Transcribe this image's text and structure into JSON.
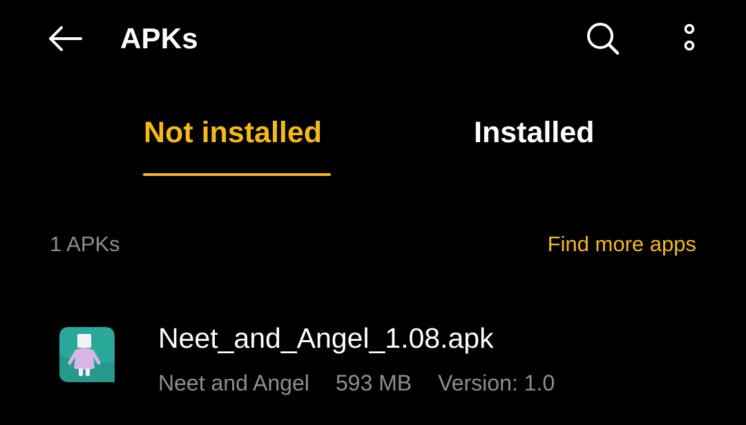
{
  "header": {
    "title": "APKs",
    "back_icon": "arrow-left-icon",
    "search_icon": "search-icon",
    "more_icon": "more-vertical-icon"
  },
  "tabs": [
    {
      "label": "Not installed",
      "active": true
    },
    {
      "label": "Installed",
      "active": false
    }
  ],
  "summary": {
    "count_label": "1 APKs",
    "find_more_label": "Find more apps"
  },
  "apks": [
    {
      "file_name": "Neet_and_Angel_1.08.apk",
      "app_name": "Neet and Angel",
      "size": "593 MB",
      "version": "Version: 1.0",
      "icon": "neet-and-angel-app-icon"
    }
  ],
  "colors": {
    "background": "#000000",
    "accent": "#f4b91a",
    "primary_text": "#ffffff",
    "secondary_text": "#8e8e8e",
    "icon_teal": "#2aa89a"
  }
}
